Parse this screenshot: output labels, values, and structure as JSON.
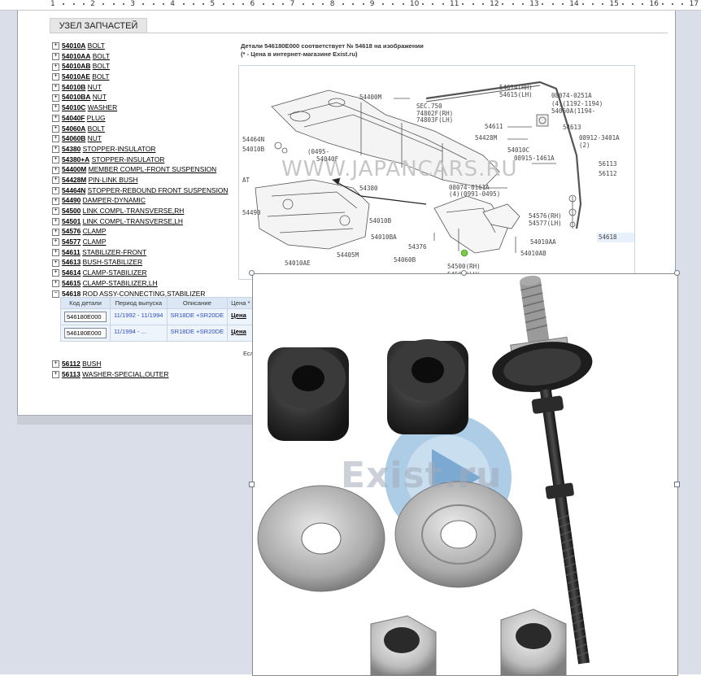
{
  "ruler": {
    "numbers": [
      "1",
      "2",
      "3",
      "4",
      "5",
      "6",
      "7",
      "8",
      "9",
      "10",
      "11",
      "12",
      "13",
      "14",
      "15",
      "16",
      "17"
    ]
  },
  "tab": {
    "label": "УЗЕЛ ЗАПЧАСТЕЙ"
  },
  "tree": [
    {
      "code": "54010A",
      "name": "BOLT"
    },
    {
      "code": "54010AA",
      "name": "BOLT"
    },
    {
      "code": "54010AB",
      "name": "BOLT"
    },
    {
      "code": "54010AE",
      "name": "BOLT"
    },
    {
      "code": "54010B",
      "name": "NUT"
    },
    {
      "code": "54010BA",
      "name": "NUT"
    },
    {
      "code": "54010C",
      "name": "WASHER"
    },
    {
      "code": "54040F",
      "name": "PLUG"
    },
    {
      "code": "54060A",
      "name": "BOLT"
    },
    {
      "code": "54060B",
      "name": "NUT"
    },
    {
      "code": "54380",
      "name": "STOPPER-INSULATOR"
    },
    {
      "code": "54380+A",
      "name": "STOPPER-INSULATOR"
    },
    {
      "code": "54400M",
      "name": "MEMBER COMPL-FRONT SUSPENSION"
    },
    {
      "code": "54428M",
      "name": "PIN-LINK BUSH"
    },
    {
      "code": "54464N",
      "name": "STOPPER-REBOUND FRONT SUSPENSION"
    },
    {
      "code": "54490",
      "name": "DAMPER-DYNAMIC"
    },
    {
      "code": "54500",
      "name": "LINK COMPL-TRANSVERSE,RH"
    },
    {
      "code": "54501",
      "name": "LINK COMPL-TRANSVERSE,LH"
    },
    {
      "code": "54576",
      "name": "CLAMP"
    },
    {
      "code": "54577",
      "name": "CLAMP"
    },
    {
      "code": "54611",
      "name": "STABILIZER-FRONT"
    },
    {
      "code": "54613",
      "name": "BUSH-STABILIZER"
    },
    {
      "code": "54614",
      "name": "CLAMP-STABILIZER"
    },
    {
      "code": "54615",
      "name": "CLAMP-STABILIZER,LH"
    },
    {
      "code": "54618",
      "name": "ROD ASSY-CONNECTING,STABILIZER"
    }
  ],
  "tree_after": [
    {
      "code": "56112",
      "name": "BUSH"
    },
    {
      "code": "56113",
      "name": "WASHER-SPECIAL,OUTER"
    }
  ],
  "parts_table": {
    "headers": [
      "Код детали",
      "Период выпуска",
      "Описание",
      "Цена *"
    ],
    "rows": [
      {
        "code": "546180E000",
        "period": "11/1992 - 11/1994",
        "desc": "SR18DE +SR20DE",
        "price": "Цена"
      },
      {
        "code": "546180E000",
        "period": "11/1994 - ...",
        "desc": "SR18DE +SR20DE",
        "price": "Цена"
      }
    ]
  },
  "header_text": {
    "line1": "Детали 546180E000 соответствует № 54618 на изображении",
    "line2": "(* - Цена в интернет-магазине Exist.ru)"
  },
  "esc_text": "Есл",
  "diagram": {
    "watermark": "WWW.JAPANCARS.RU",
    "labels": [
      "54400M",
      "SEC.750",
      "74802F(RH)",
      "74803F(LH)",
      "54614(RH)",
      "54615(LH)",
      "08074-0251A",
      "(4)(1192-1194)",
      "54060A(1194-",
      "54611",
      "54613",
      "08912-3401A",
      "(2)",
      "54464N",
      "54010B",
      "54428M",
      "54010C",
      "08915-1461A",
      "56113",
      "56112",
      "(0495-",
      "54040F",
      "54380",
      "AT",
      "54490",
      "08074-0161A",
      "(4)(0991-0495)",
      "54576(RH)",
      "54577(LH)",
      "54010B",
      "54010BA",
      "54376",
      "54060B",
      "54010AA",
      "54010AB",
      "54618",
      "54405M",
      "54010AE",
      "54500(RH)",
      "54501(LH)"
    ]
  },
  "photo": {
    "watermark": "Exist.ru"
  },
  "colors": {
    "accent_link": "#3050c0",
    "table_header": "#dbe7f5",
    "page_bg": "#d9dee8"
  }
}
